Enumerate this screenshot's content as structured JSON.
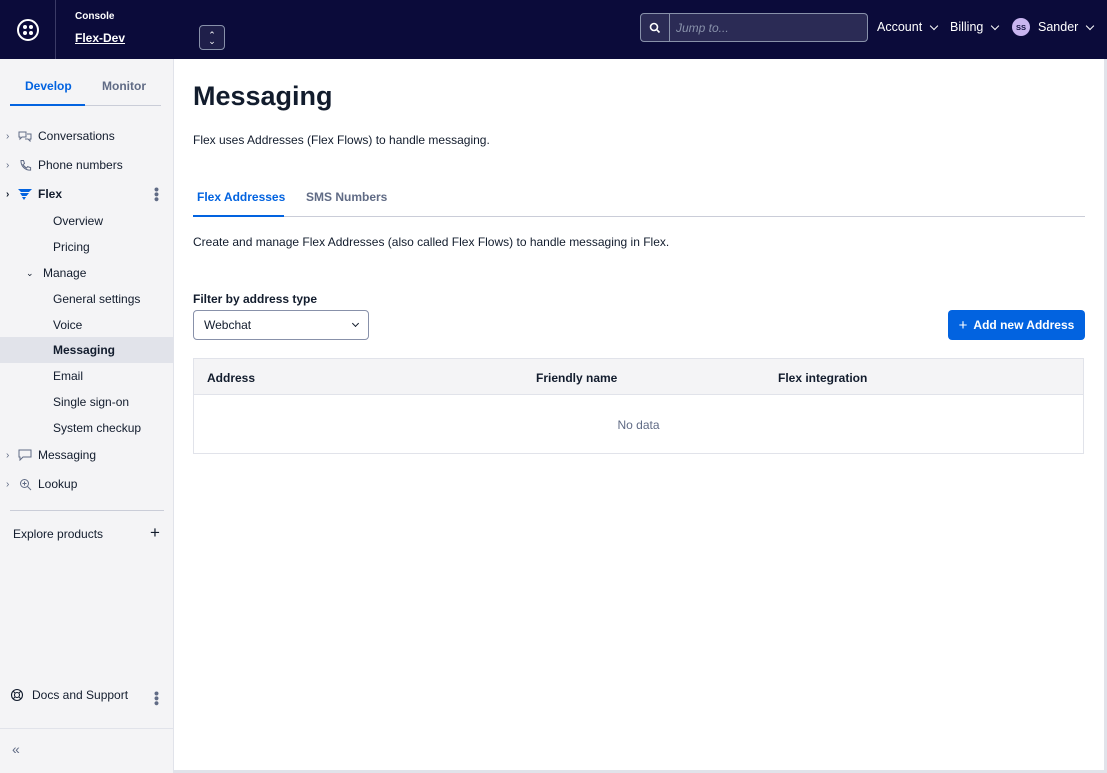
{
  "topbar": {
    "console_label": "Console",
    "project_name": "Flex-Dev",
    "search_placeholder": "Jump to...",
    "account_label": "Account",
    "billing_label": "Billing",
    "user_initials": "SS",
    "user_name": "Sander"
  },
  "sidebar": {
    "tabs": {
      "develop": "Develop",
      "monitor": "Monitor"
    },
    "items": {
      "conversations": "Conversations",
      "phone_numbers": "Phone numbers",
      "flex": "Flex",
      "overview": "Overview",
      "pricing": "Pricing",
      "manage": "Manage",
      "general_settings": "General settings",
      "voice": "Voice",
      "messaging_sub": "Messaging",
      "email": "Email",
      "sso": "Single sign-on",
      "system_checkup": "System checkup",
      "messaging": "Messaging",
      "lookup": "Lookup"
    },
    "explore_products": "Explore products",
    "docs_support": "Docs and Support"
  },
  "main": {
    "title": "Messaging",
    "description": "Flex uses Addresses (Flex Flows) to handle messaging.",
    "tabs": {
      "flex_addresses": "Flex Addresses",
      "sms_numbers": "SMS Numbers"
    },
    "tab_description": "Create and manage Flex Addresses (also called Flex Flows) to handle messaging in Flex.",
    "filter_label": "Filter by address type",
    "filter_value": "Webchat",
    "add_button": "Add new Address",
    "table": {
      "columns": {
        "address": "Address",
        "friendly_name": "Friendly name",
        "flex_integration": "Flex integration"
      },
      "empty": "No data"
    }
  },
  "colors": {
    "topbar": "#0b0b3a",
    "accent": "#0263e0",
    "sidebar_bg": "#f4f4f6"
  }
}
